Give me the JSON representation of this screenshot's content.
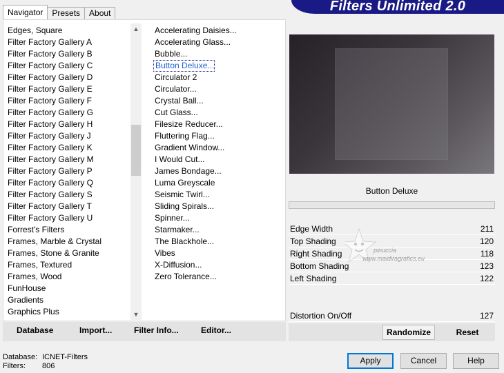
{
  "window": {
    "banner_title": "Filters Unlimited 2.0"
  },
  "tabs": [
    {
      "label": "Navigator",
      "active": true
    },
    {
      "label": "Presets",
      "active": false
    },
    {
      "label": "About",
      "active": false
    }
  ],
  "categories": [
    "Edges, Square",
    "Filter Factory Gallery A",
    "Filter Factory Gallery B",
    "Filter Factory Gallery C",
    "Filter Factory Gallery D",
    "Filter Factory Gallery E",
    "Filter Factory Gallery F",
    "Filter Factory Gallery G",
    "Filter Factory Gallery H",
    "Filter Factory Gallery J",
    "Filter Factory Gallery K",
    "Filter Factory Gallery M",
    "Filter Factory Gallery P",
    "Filter Factory Gallery Q",
    "Filter Factory Gallery S",
    "Filter Factory Gallery T",
    "Filter Factory Gallery U",
    "Forrest's Filters",
    "Frames, Marble & Crystal",
    "Frames, Stone & Granite",
    "Frames, Textured",
    "Frames, Wood",
    "FunHouse",
    "Gradients",
    "Graphics Plus"
  ],
  "filters": [
    "Accelerating Daisies...",
    "Accelerating Glass...",
    "Bubble...",
    "Button Deluxe...",
    "Circulator 2",
    "Circulator...",
    "Crystal Ball...",
    "Cut Glass...",
    "Filesize Reducer...",
    "Fluttering Flag...",
    "Gradient Window...",
    "I Would Cut...",
    "James Bondage...",
    "Luma Greyscale",
    "Seismic Twirl...",
    "Sliding Spirals...",
    "Spinner...",
    "Starmaker...",
    "The Blackhole...",
    "Vibes",
    "X-Diffusion...",
    "Zero Tolerance..."
  ],
  "selected_filter_index": 3,
  "left_buttons": {
    "database": "Database",
    "import": "Import...",
    "filter_info": "Filter Info...",
    "editor": "Editor..."
  },
  "filter_title": "Button Deluxe",
  "sliders": [
    {
      "label": "Edge Width",
      "value": "211"
    },
    {
      "label": "Top Shading",
      "value": "120"
    },
    {
      "label": "Right Shading",
      "value": "118"
    },
    {
      "label": "Bottom Shading",
      "value": "123"
    },
    {
      "label": "Left Shading",
      "value": "122"
    }
  ],
  "distortion": {
    "label": "Distortion On/Off",
    "value": "127"
  },
  "watermark": {
    "line1": "pinuccia",
    "line2": "www.maidiragrafics.eu"
  },
  "right_buttons": {
    "randomize": "Randomize",
    "reset": "Reset"
  },
  "status": {
    "database_label": "Database:",
    "database_value": "ICNET-Filters",
    "filters_label": "Filters:",
    "filters_value": "806"
  },
  "dialog_buttons": {
    "apply": "Apply",
    "cancel": "Cancel",
    "help": "Help"
  },
  "colors": {
    "banner": "#1a1a86",
    "selection_text": "#1a5fd0",
    "apply_border": "#0078d7"
  }
}
